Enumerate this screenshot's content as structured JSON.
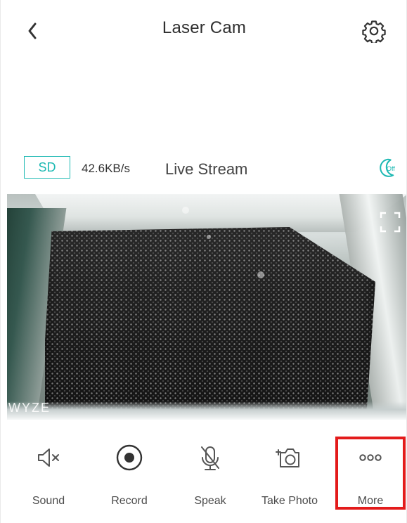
{
  "header": {
    "title": "Laser Cam",
    "back_icon": "chevron-left-icon",
    "settings_icon": "gear-icon"
  },
  "stream": {
    "quality": "SD",
    "bitrate": "42.6KB/s",
    "label": "Live Stream",
    "night_vision_icon": "night-vision-icon",
    "night_vision_state": "Off",
    "accent": "#1DB9B3"
  },
  "video": {
    "watermark": "WYZE",
    "fullscreen_icon": "fullscreen-icon"
  },
  "controls": [
    {
      "label": "Sound",
      "icon": "mute-icon"
    },
    {
      "label": "Record",
      "icon": "record-icon"
    },
    {
      "label": "Speak",
      "icon": "microphone-off-icon"
    },
    {
      "label": "Take Photo",
      "icon": "camera-icon"
    },
    {
      "label": "More",
      "icon": "more-icon"
    }
  ],
  "highlight": {
    "target": "More",
    "color": "#E31B1B"
  }
}
